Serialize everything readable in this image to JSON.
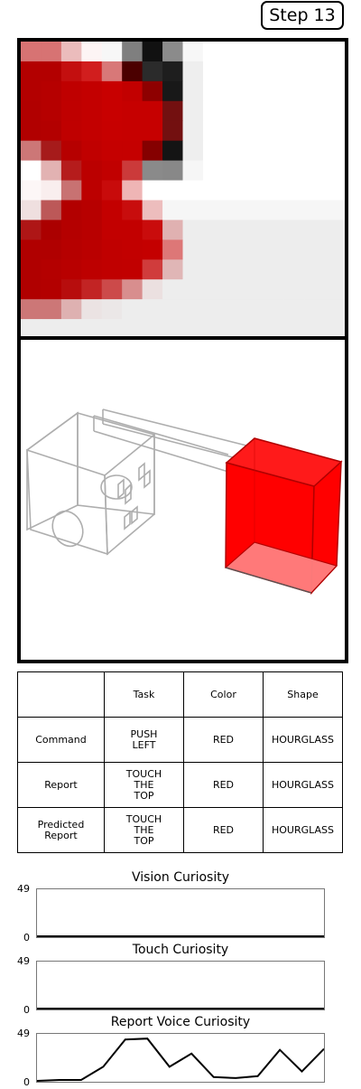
{
  "step_label": "Step 13",
  "vision": {
    "cols": 16,
    "rows": 15,
    "pixels": [
      [
        "#d77373",
        "#d77373",
        "#ebbcbc",
        "#fdf4f4",
        "#f7f7f7",
        "#7f7f7f",
        "#111111",
        "#8b8b8b",
        "#f7f7f7",
        "#ffffff",
        "#ffffff",
        "#ffffff",
        "#ffffff",
        "#ffffff",
        "#ffffff",
        "#ffffff"
      ],
      [
        "#b30000",
        "#b30000",
        "#c30f0f",
        "#d11e1e",
        "#d87878",
        "#4b0000",
        "#2b2b2b",
        "#1e1e1e",
        "#eeeeee",
        "#ffffff",
        "#ffffff",
        "#ffffff",
        "#ffffff",
        "#ffffff",
        "#ffffff",
        "#ffffff"
      ],
      [
        "#b30000",
        "#b60000",
        "#bf0000",
        "#c30000",
        "#c80000",
        "#c20000",
        "#8e0000",
        "#181818",
        "#eeeeee",
        "#ffffff",
        "#ffffff",
        "#ffffff",
        "#ffffff",
        "#ffffff",
        "#ffffff",
        "#ffffff"
      ],
      [
        "#b10000",
        "#b60000",
        "#bf0000",
        "#c30000",
        "#c80000",
        "#c60000",
        "#c60000",
        "#731010",
        "#eeeeee",
        "#ffffff",
        "#ffffff",
        "#ffffff",
        "#ffffff",
        "#ffffff",
        "#ffffff",
        "#ffffff"
      ],
      [
        "#b10000",
        "#b30000",
        "#bf0000",
        "#c30000",
        "#c70000",
        "#c60000",
        "#c60000",
        "#731010",
        "#eeeeee",
        "#ffffff",
        "#ffffff",
        "#ffffff",
        "#ffffff",
        "#ffffff",
        "#ffffff",
        "#ffffff"
      ],
      [
        "#cc7777",
        "#a61b1b",
        "#b60000",
        "#c00000",
        "#c50000",
        "#c50000",
        "#850000",
        "#141414",
        "#eeeeee",
        "#ffffff",
        "#ffffff",
        "#ffffff",
        "#ffffff",
        "#ffffff",
        "#ffffff",
        "#ffffff"
      ],
      [
        "#ffffff",
        "#e2b2b2",
        "#b51c1c",
        "#bb0000",
        "#c10000",
        "#cb3a3a",
        "#8a8a8a",
        "#888888",
        "#f6f6f6",
        "#ffffff",
        "#ffffff",
        "#ffffff",
        "#ffffff",
        "#ffffff",
        "#ffffff",
        "#ffffff"
      ],
      [
        "#fdf7f7",
        "#f9eeee",
        "#c87272",
        "#bc0000",
        "#c80b0b",
        "#efb5b5",
        "#ffffff",
        "#ffffff",
        "#ffffff",
        "#ffffff",
        "#ffffff",
        "#ffffff",
        "#ffffff",
        "#ffffff",
        "#ffffff",
        "#ffffff"
      ],
      [
        "#efdfdf",
        "#bc5858",
        "#b20000",
        "#b70000",
        "#c30000",
        "#c80d0d",
        "#edbdbd",
        "#f6f6f6",
        "#f6f6f6",
        "#f6f6f6",
        "#f6f6f6",
        "#f6f6f6",
        "#f6f6f6",
        "#f6f6f6",
        "#f6f6f6",
        "#f6f6f6"
      ],
      [
        "#ae1616",
        "#ab0000",
        "#b40000",
        "#b80000",
        "#c20000",
        "#c20000",
        "#c90c0c",
        "#e0b1b1",
        "#ededed",
        "#ededed",
        "#ededed",
        "#ededed",
        "#ededed",
        "#ededed",
        "#ededed",
        "#ededed"
      ],
      [
        "#b00000",
        "#b00000",
        "#b60000",
        "#ba0000",
        "#c00000",
        "#c20000",
        "#c40000",
        "#dd7777",
        "#ededed",
        "#ededed",
        "#ededed",
        "#ededed",
        "#ededed",
        "#ededed",
        "#ededed",
        "#ededed"
      ],
      [
        "#b00000",
        "#b40000",
        "#b80000",
        "#bd0000",
        "#c00000",
        "#c10000",
        "#d03c3c",
        "#e0b6b6",
        "#ededed",
        "#ededed",
        "#ededed",
        "#ededed",
        "#ededed",
        "#ededed",
        "#ededed",
        "#ededed"
      ],
      [
        "#b00000",
        "#b30000",
        "#b70d0d",
        "#c22424",
        "#cc4a4a",
        "#d88e8e",
        "#ebe0e0",
        "#ededed",
        "#ededed",
        "#ededed",
        "#ededed",
        "#ededed",
        "#ededed",
        "#ededed",
        "#ededed",
        "#ededed"
      ],
      [
        "#cc7777",
        "#cc7777",
        "#deb1b1",
        "#ebe3e3",
        "#ebe7e7",
        "#ededed",
        "#ededed",
        "#ededed",
        "#ededed",
        "#ededed",
        "#ededed",
        "#ededed",
        "#ededed",
        "#ededed",
        "#ededed",
        "#ededed"
      ],
      [
        "#ededed",
        "#ededed",
        "#ededed",
        "#ededed",
        "#ededed",
        "#ededed",
        "#ededed",
        "#ededed",
        "#ededed",
        "#ededed",
        "#ededed",
        "#ededed",
        "#ededed",
        "#ededed",
        "#ededed",
        "#ededed"
      ]
    ]
  },
  "table": {
    "header": [
      "",
      "Task",
      "Color",
      "Shape"
    ],
    "rows": [
      {
        "label": [
          "Command"
        ],
        "task": [
          "PUSH",
          "LEFT"
        ],
        "color": "RED",
        "shape": "HOURGLASS"
      },
      {
        "label": [
          "Report"
        ],
        "task": [
          "TOUCH",
          "THE",
          "TOP"
        ],
        "color": "RED",
        "shape": "HOURGLASS"
      },
      {
        "label": [
          "Predicted",
          "Report"
        ],
        "task": [
          "TOUCH",
          "THE",
          "TOP"
        ],
        "color": "RED",
        "shape": "HOURGLASS"
      }
    ]
  },
  "charts": [
    {
      "title": "Vision Curiosity",
      "ymax": "49",
      "ymin": "0",
      "values": [
        0,
        0,
        0,
        0,
        0,
        0,
        0,
        0,
        0,
        0,
        0,
        0,
        0,
        0,
        0
      ],
      "ylim": [
        0,
        49
      ]
    },
    {
      "title": "Touch Curiosity",
      "ymax": "49",
      "ymin": "0",
      "values": [
        0,
        0,
        0,
        0,
        0,
        0,
        0,
        0,
        0,
        0,
        0,
        0,
        0,
        0,
        0
      ],
      "ylim": [
        0,
        49
      ]
    },
    {
      "title": "Report Voice Curiosity",
      "ymax": "49",
      "ymin": "0",
      "values": [
        0,
        1,
        1,
        15,
        44,
        45,
        15,
        29,
        4,
        3,
        5,
        33,
        10,
        34
      ],
      "ylim": [
        0,
        49
      ]
    }
  ]
}
